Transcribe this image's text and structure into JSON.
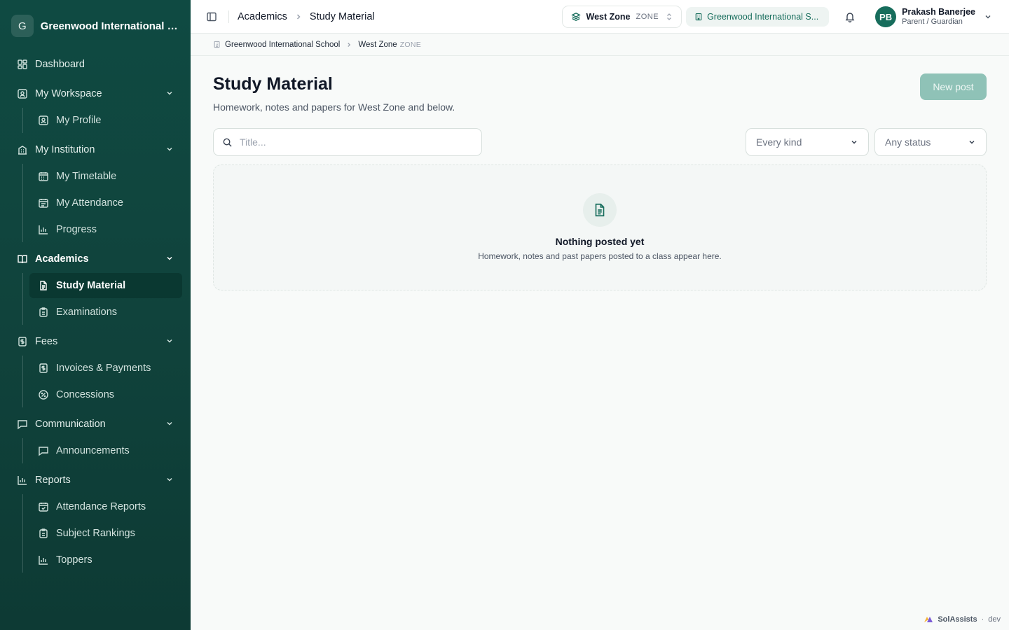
{
  "brand": {
    "initial": "G",
    "name": "Greenwood International Sc..."
  },
  "sidebar": {
    "dashboard": "Dashboard",
    "groups": [
      {
        "label": "My Workspace",
        "items": [
          "My Profile"
        ]
      },
      {
        "label": "My Institution",
        "items": [
          "My Timetable",
          "My Attendance",
          "Progress"
        ]
      },
      {
        "label": "Academics",
        "items": [
          "Study Material",
          "Examinations"
        ]
      },
      {
        "label": "Fees",
        "items": [
          "Invoices & Payments",
          "Concessions"
        ]
      },
      {
        "label": "Communication",
        "items": [
          "Announcements"
        ]
      },
      {
        "label": "Reports",
        "items": [
          "Attendance Reports",
          "Subject Rankings",
          "Toppers"
        ]
      }
    ]
  },
  "topbar": {
    "breadcrumb": [
      "Academics",
      "Study Material"
    ],
    "zone": {
      "name": "West Zone",
      "tag": "ZONE"
    },
    "school": "Greenwood International S...",
    "user": {
      "initials": "PB",
      "name": "Prakash Banerjee",
      "role": "Parent / Guardian"
    }
  },
  "subbar": {
    "school": "Greenwood International School",
    "zone": "West Zone",
    "zone_tag": "ZONE"
  },
  "main": {
    "title": "Study Material",
    "subtitle": "Homework, notes and papers for West Zone and below.",
    "new_post": "New post",
    "search_placeholder": "Title...",
    "kind_filter": "Every kind",
    "status_filter": "Any status",
    "empty_title": "Nothing posted yet",
    "empty_desc": "Homework, notes and past papers posted to a class appear here."
  },
  "footer": {
    "name": "SolAssists",
    "env": "dev"
  },
  "colors": {
    "sidebar": "#0f4a42",
    "accent": "#176d5c",
    "button_disabled": "#8fc2b7"
  }
}
